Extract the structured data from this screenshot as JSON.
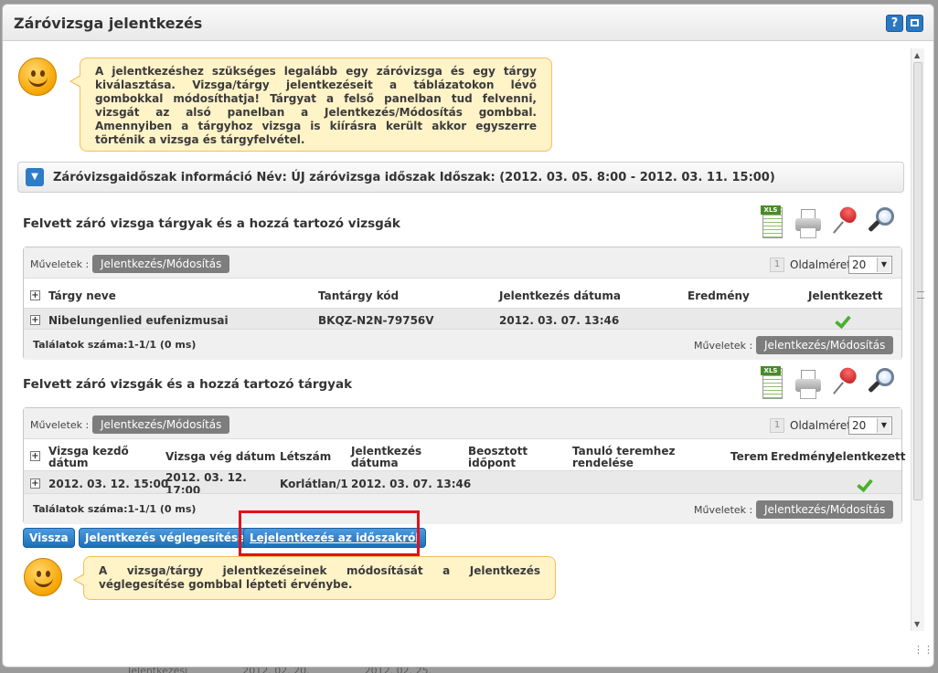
{
  "window": {
    "title": "Záróvizsga jelentkezés",
    "help_label": "?"
  },
  "top_note": "A jelentkezéshez szükséges legalább egy záróvizsga és egy tárgy kiválasztása. Vizsga/tárgy jelentkezéseit a táblázatokon lévő gombokkal módosíthatja! Tárgyat a felső panelban tud felvenni, vizsgát az alsó panelban a Jelentkezés/Módosítás gombbal. Amennyiben a tárgyhoz vizsga is kiírásra került akkor egyszerre történik a vizsga és tárgyfelvétel.",
  "info_bar": "Záróvizsgaidőszak információ Név: ÚJ záróvizsga időszak Időszak: (2012. 03. 05. 8:00 - 2012. 03. 11. 15:00)",
  "export_icons": {
    "xls": "XLS"
  },
  "panel1": {
    "title": "Felvett záró vizsga tárgyak és a hozzá tartozó vizsgák",
    "ops_label": "Műveletek :",
    "op_button": "Jelentkezés/Módosítás",
    "page": "1",
    "page_size_label": "Oldalméret",
    "page_size": "20",
    "headers": [
      "Tárgy neve",
      "Tantárgy kód",
      "Jelentkezés dátuma",
      "Eredmény",
      "Jelentkezett"
    ],
    "row": {
      "subject": "Nibelungenlied eufenizmusai",
      "code": "BKQZ-N2N-79756V",
      "date": "2012. 03. 07. 13:46",
      "result": ""
    },
    "footer": "Találatok száma:1-1/1 (0 ms)",
    "footer_ops_label": "Műveletek :",
    "footer_op_button": "Jelentkezés/Módosítás"
  },
  "panel2": {
    "title": "Felvett záró vizsgák és a hozzá tartozó tárgyak",
    "ops_label": "Műveletek :",
    "op_button": "Jelentkezés/Módosítás",
    "page": "1",
    "page_size_label": "Oldalméret",
    "page_size": "20",
    "headers": [
      "Vizsga kezdő dátum",
      "Vizsga vég dátum",
      "Létszám",
      "Jelentkezés dátuma",
      "Beosztott időpont",
      "Tanuló teremhez rendelése",
      "Terem",
      "Eredmény",
      "Jelentkezett"
    ],
    "row": {
      "start": "2012. 03. 12. 15:00",
      "end": "2012. 03. 12. 17:00",
      "capacity": "Korlátlan/1",
      "date": "2012. 03. 07. 13:46"
    },
    "footer": "Találatok száma:1-1/1 (0 ms)",
    "footer_ops_label": "Műveletek :",
    "footer_op_button": "Jelentkezés/Módosítás"
  },
  "buttons": {
    "back": "Vissza",
    "finalize": "Jelentkezés véglegesítése",
    "unregister": "Lejelentkezés az időszakról"
  },
  "bottom_note": "A vizsga/tárgy jelentkezéseinek módosítását a Jelentkezés véglegesítése gombbal lépteti érvénybe.",
  "background": {
    "row": [
      "Jelentkezési",
      "2012. 02. 20.",
      "2012. 02. 25."
    ]
  }
}
